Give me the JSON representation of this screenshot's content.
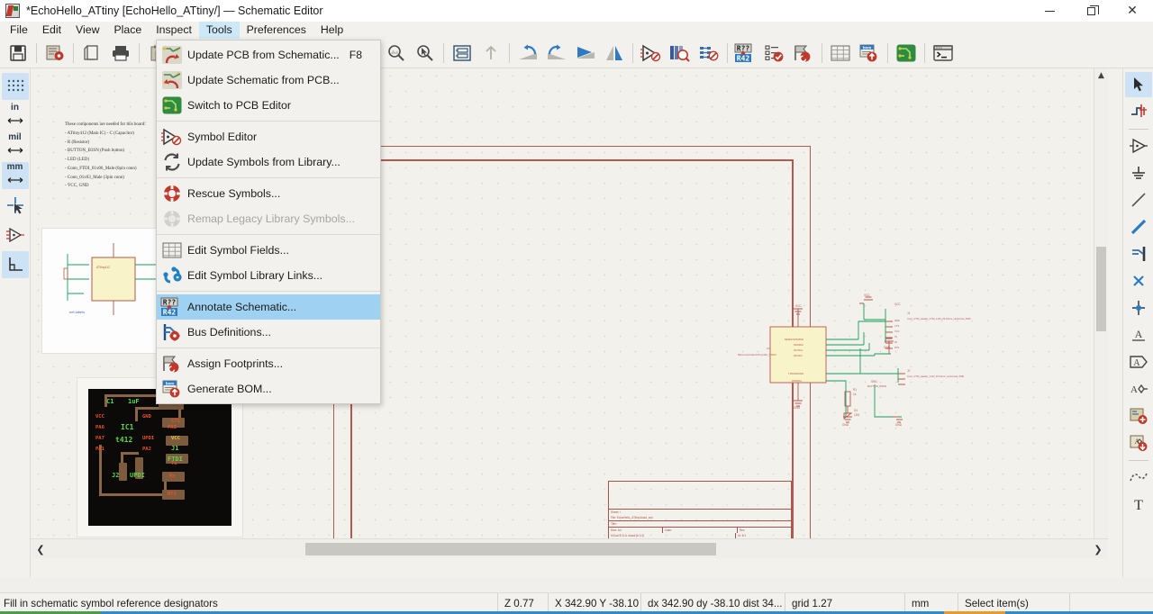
{
  "window": {
    "title": "*EchoHello_ATtiny [EchoHello_ATtiny/] — Schematic Editor",
    "app_icon": "kicad-schematic-icon",
    "controls": {
      "minimize": "minimize-button",
      "maximize": "maximize-button",
      "close": "close-button"
    }
  },
  "menubar": {
    "items": [
      {
        "label": "File",
        "open": false
      },
      {
        "label": "Edit",
        "open": false
      },
      {
        "label": "View",
        "open": false
      },
      {
        "label": "Place",
        "open": false
      },
      {
        "label": "Inspect",
        "open": false
      },
      {
        "label": "Tools",
        "open": true
      },
      {
        "label": "Preferences",
        "open": false
      },
      {
        "label": "Help",
        "open": false
      }
    ]
  },
  "tools_menu": {
    "items": [
      {
        "label": "Update PCB from Schematic...",
        "shortcut": "F8",
        "icon": "update-pcb-from-schematic-icon",
        "highlighted": false,
        "disabled": false,
        "separator_after": false
      },
      {
        "label": "Update Schematic from PCB...",
        "shortcut": "",
        "icon": "update-schematic-from-pcb-icon",
        "highlighted": false,
        "disabled": false,
        "separator_after": false
      },
      {
        "label": "Switch to PCB Editor",
        "shortcut": "",
        "icon": "pcb-editor-icon",
        "highlighted": false,
        "disabled": false,
        "separator_after": true
      },
      {
        "label": "Symbol Editor",
        "shortcut": "",
        "icon": "symbol-editor-icon",
        "highlighted": false,
        "disabled": false,
        "separator_after": false
      },
      {
        "label": "Update Symbols from Library...",
        "shortcut": "",
        "icon": "refresh-symbols-icon",
        "highlighted": false,
        "disabled": false,
        "separator_after": true
      },
      {
        "label": "Rescue Symbols...",
        "shortcut": "",
        "icon": "rescue-symbols-icon",
        "highlighted": false,
        "disabled": false,
        "separator_after": false
      },
      {
        "label": "Remap Legacy Library Symbols...",
        "shortcut": "",
        "icon": "remap-symbols-icon",
        "highlighted": false,
        "disabled": true,
        "separator_after": true
      },
      {
        "label": "Edit Symbol Fields...",
        "shortcut": "",
        "icon": "edit-symbol-fields-icon",
        "highlighted": false,
        "disabled": false,
        "separator_after": false
      },
      {
        "label": "Edit Symbol Library Links...",
        "shortcut": "",
        "icon": "edit-symbol-library-links-icon",
        "highlighted": false,
        "disabled": false,
        "separator_after": true
      },
      {
        "label": "Annotate Schematic...",
        "shortcut": "",
        "icon": "annotate-schematic-icon",
        "highlighted": true,
        "disabled": false,
        "separator_after": false
      },
      {
        "label": "Bus Definitions...",
        "shortcut": "",
        "icon": "bus-definitions-icon",
        "highlighted": false,
        "disabled": false,
        "separator_after": true
      },
      {
        "label": "Assign Footprints...",
        "shortcut": "",
        "icon": "assign-footprints-icon",
        "highlighted": false,
        "disabled": false,
        "separator_after": false
      },
      {
        "label": "Generate BOM...",
        "shortcut": "",
        "icon": "generate-bom-icon",
        "highlighted": false,
        "disabled": false,
        "separator_after": false
      }
    ]
  },
  "toolbar": {
    "groups": [
      {
        "buttons": [
          {
            "icon": "save-icon"
          }
        ]
      },
      {
        "buttons": [
          {
            "icon": "page-settings-icon"
          }
        ]
      },
      {
        "buttons": [
          {
            "icon": "print-preview-icon"
          },
          {
            "icon": "print-icon"
          }
        ]
      },
      {
        "buttons": [
          {
            "icon": "paste-icon"
          },
          {
            "icon": "cut-icon"
          },
          {
            "icon": "copy-icon"
          },
          {
            "icon": "delete-icon"
          }
        ]
      },
      {
        "buttons": [
          {
            "icon": "refresh-icon"
          },
          {
            "icon": "zoom-in-icon"
          },
          {
            "icon": "zoom-out-icon"
          },
          {
            "icon": "zoom-fit-page-icon"
          },
          {
            "icon": "zoom-fit-objects-icon"
          },
          {
            "icon": "zoom-to-selection-icon"
          }
        ]
      },
      {
        "buttons": [
          {
            "icon": "hierarchy-navigator-icon"
          },
          {
            "icon": "leave-sheet-icon"
          }
        ]
      },
      {
        "buttons": [
          {
            "icon": "undo-icon"
          },
          {
            "icon": "redo-icon"
          },
          {
            "icon": "rotate-icon"
          },
          {
            "icon": "mirror-icon"
          }
        ]
      },
      {
        "buttons": [
          {
            "icon": "symbol-editor-icon"
          },
          {
            "icon": "symbol-library-browser-icon"
          },
          {
            "icon": "footprint-editor-icon"
          }
        ]
      },
      {
        "buttons": [
          {
            "icon": "annotate-schematic-icon"
          },
          {
            "icon": "erc-icon"
          },
          {
            "icon": "assign-footprints-icon"
          }
        ]
      },
      {
        "buttons": [
          {
            "icon": "symbol-fields-table-icon"
          },
          {
            "icon": "generate-bom-icon"
          }
        ]
      },
      {
        "buttons": [
          {
            "icon": "switch-to-pcb-editor-icon"
          }
        ]
      },
      {
        "buttons": [
          {
            "icon": "scripting-console-icon"
          }
        ]
      }
    ]
  },
  "left_toolbar": {
    "buttons": [
      {
        "icon": "toggle-grid-icon",
        "label": "",
        "selected": true
      },
      {
        "icon": "units-inches-icon",
        "label": "in",
        "selected": false
      },
      {
        "icon": "units-mils-icon",
        "label": "mil",
        "selected": false
      },
      {
        "icon": "units-millimeters-icon",
        "label": "mm",
        "selected": true
      },
      {
        "icon": "cursor-fullscreen-icon",
        "label": "",
        "selected": false
      },
      {
        "icon": "hidden-pins-icon",
        "label": "",
        "selected": false
      },
      {
        "icon": "free-angle-wires-icon",
        "label": "",
        "selected": true
      }
    ]
  },
  "right_toolbar": {
    "buttons": [
      {
        "icon": "select-arrow-icon",
        "selected": true,
        "separator_after": false
      },
      {
        "icon": "highlight-net-icon",
        "selected": false,
        "separator_after": true
      },
      {
        "icon": "place-symbol-icon",
        "selected": false,
        "separator_after": false
      },
      {
        "icon": "place-power-port-icon",
        "selected": false,
        "separator_after": false
      },
      {
        "icon": "draw-wire-icon",
        "selected": false,
        "separator_after": false
      },
      {
        "icon": "draw-bus-icon",
        "selected": false,
        "separator_after": false
      },
      {
        "icon": "wire-to-bus-entry-icon",
        "selected": false,
        "separator_after": false
      },
      {
        "icon": "no-connect-flag-icon",
        "selected": false,
        "separator_after": false
      },
      {
        "icon": "junction-icon",
        "selected": false,
        "separator_after": false
      },
      {
        "icon": "net-label-icon",
        "selected": false,
        "separator_after": false
      },
      {
        "icon": "global-label-icon",
        "selected": false,
        "separator_after": false
      },
      {
        "icon": "hierarchical-label-icon",
        "selected": false,
        "separator_after": false
      },
      {
        "icon": "add-hierarchical-sheet-icon",
        "selected": false,
        "separator_after": false
      },
      {
        "icon": "import-sheet-pin-icon",
        "selected": false,
        "separator_after": true
      },
      {
        "icon": "draw-graphic-polygon-icon",
        "selected": false,
        "separator_after": false
      },
      {
        "icon": "place-text-icon",
        "selected": false,
        "separator_after": false
      }
    ]
  },
  "canvas": {
    "note": {
      "lines": [
        "These components are needed for this board:",
        "- ATtiny412 (Main IC) - C (Capacitor)",
        "- R (Resistor)",
        "- BUTTON_B3SN (Push button)",
        "- LED (LED)",
        "- Conn_FTDI_01x06_Male (6pin conn)",
        "- Conn_01x03_Male (3pin conn)",
        "- VCC, GND"
      ]
    },
    "pcb_preview": {
      "labels": [
        {
          "text": "C1",
          "color": "#5cd94a"
        },
        {
          "text": "1uF",
          "color": "#5cd94a"
        },
        {
          "text": "GND",
          "color": "#e8522a"
        },
        {
          "text": "VCC",
          "color": "#e8522a"
        },
        {
          "text": "GND",
          "color": "#e8522a"
        },
        {
          "text": "CTS",
          "color": "#e8522a"
        },
        {
          "text": "PA6",
          "color": "#e8522a"
        },
        {
          "text": "IC1",
          "color": "#5cd94a"
        },
        {
          "text": "PA3",
          "color": "#e8522a"
        },
        {
          "text": "PA7",
          "color": "#e8522a"
        },
        {
          "text": "t412",
          "color": "#5cd94a"
        },
        {
          "text": "UPDI",
          "color": "#e8522a"
        },
        {
          "text": "VCC",
          "color": "#e8c03a"
        },
        {
          "text": "PA1",
          "color": "#e8522a"
        },
        {
          "text": "PA2",
          "color": "#e8522a"
        },
        {
          "text": "J1",
          "color": "#5cd94a"
        },
        {
          "text": "FTDI",
          "color": "#5cd94a"
        },
        {
          "text": "Tx",
          "color": "#e8522a"
        },
        {
          "text": "J2",
          "color": "#5cd94a"
        },
        {
          "text": "UPDI",
          "color": "#5cd94a"
        },
        {
          "text": "Rx",
          "color": "#e8522a"
        },
        {
          "text": "RTS",
          "color": "#e8522a"
        }
      ]
    },
    "schematic": {
      "main_symbol_ref": "U1",
      "main_symbol_value": "MicrocontrollerATtiny412_SSFR",
      "connector_j1": "Conn_FTDI_Header_FTDI_1x06_P2.54mm_Horizontal_SMD",
      "connector_j2": "Conn_FTDI_Header_1x03_P2.54mm_Horizontal_SMD",
      "refs": [
        "VCC",
        "GND",
        "R1",
        "D1",
        "LED",
        "SW1",
        "BUTTON_B3SN",
        "J1",
        "J2"
      ],
      "pins_left": [
        "RESET/UPDI/PA0",
        "PA6/SDA",
        "PA7/SCL",
        "PA1/SCI",
        "TXD/PA0/GND",
        "RXD/PA1"
      ],
      "title_block": {
        "sheet": "Sheet: /",
        "file": "File: EchoHello_ATtiny.kicad_sch",
        "title": "Title:",
        "size": "Size: A4",
        "date": "Date:",
        "rev": "Rev:",
        "kicad": "KiCad E.D.A.  kicad (6.0.2)",
        "id": "Id: 1/1"
      }
    },
    "scrollbars": {
      "left_arrow": "scroll-left-icon",
      "right_arrow": "scroll-right-icon",
      "up_arrow": "scroll-up-icon",
      "down_arrow": "scroll-down-icon"
    }
  },
  "statusbar": {
    "message": "Fill in schematic symbol reference designators",
    "zoom": "Z 0.77",
    "coords": "X 342.90  Y -38.10",
    "delta": "dx 342.90  dy -38.10  dist 34...",
    "grid": "grid 1.27",
    "units": "mm",
    "mode": "Select item(s)"
  },
  "colors": {
    "accent_blue": "#9fd2f2",
    "selected_toolbar": "#cde3f5",
    "menu_open": "#cde8f7",
    "schematic_red": "#b3594d",
    "schematic_green": "#16a05a",
    "window_bg": "#f2f1ee"
  }
}
